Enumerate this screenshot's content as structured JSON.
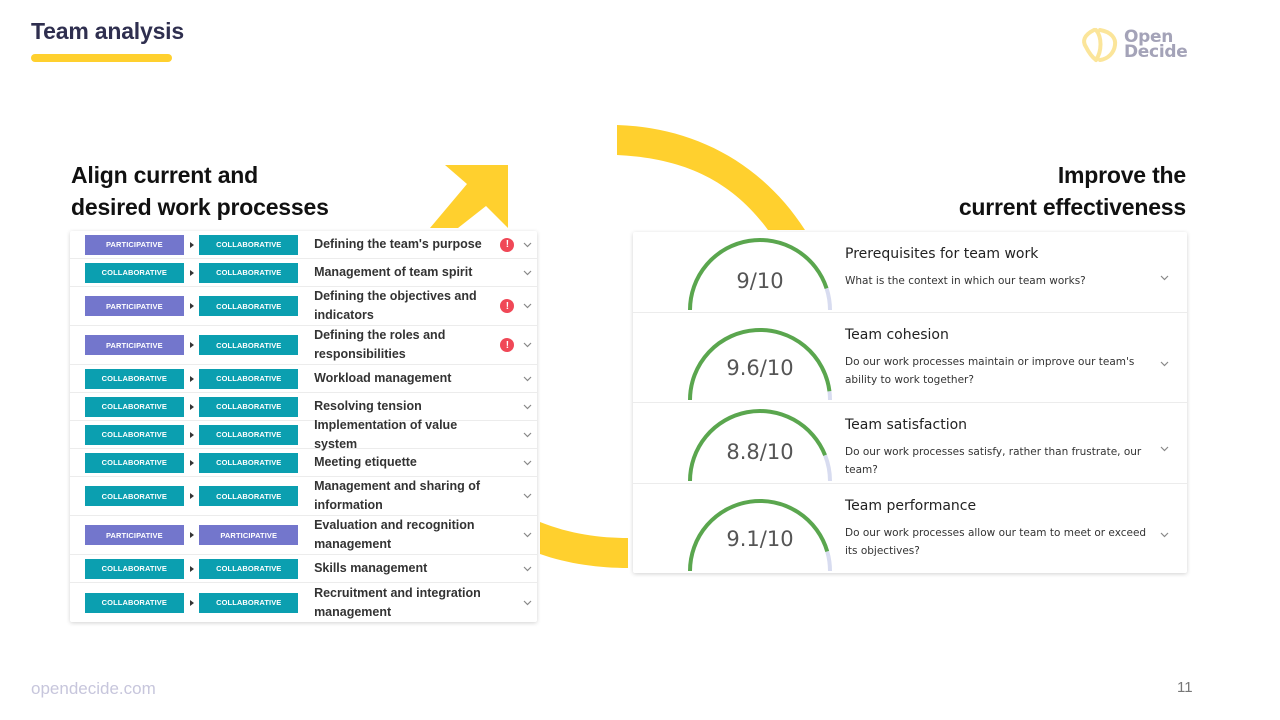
{
  "header": {
    "title": "Team analysis",
    "logo": {
      "line1": "Open",
      "line2": "Decide",
      "icon": "open-decide-logo-icon"
    }
  },
  "colors": {
    "accent_yellow": "#ffd02e",
    "participative": "#7376cc",
    "collaborative": "#0b9fb0",
    "alert": "#f04857",
    "gauge_fill": "#5aa64e",
    "gauge_track": "#d8dcf0"
  },
  "left": {
    "heading_line1": "Align current and",
    "heading_line2": "desired work processes",
    "rows": [
      {
        "current": "PARTICIPATIVE",
        "desired": "COLLABORATIVE",
        "name": "Defining the team's purpose",
        "alert": true
      },
      {
        "current": "COLLABORATIVE",
        "desired": "COLLABORATIVE",
        "name": "Management of team spirit",
        "alert": false
      },
      {
        "current": "PARTICIPATIVE",
        "desired": "COLLABORATIVE",
        "name": "Defining the objectives and indicators",
        "alert": true
      },
      {
        "current": "PARTICIPATIVE",
        "desired": "COLLABORATIVE",
        "name": "Defining the roles and responsibilities",
        "alert": true
      },
      {
        "current": "COLLABORATIVE",
        "desired": "COLLABORATIVE",
        "name": "Workload management",
        "alert": false
      },
      {
        "current": "COLLABORATIVE",
        "desired": "COLLABORATIVE",
        "name": "Resolving tension",
        "alert": false
      },
      {
        "current": "COLLABORATIVE",
        "desired": "COLLABORATIVE",
        "name": "Implementation of value system",
        "alert": false
      },
      {
        "current": "COLLABORATIVE",
        "desired": "COLLABORATIVE",
        "name": "Meeting etiquette",
        "alert": false
      },
      {
        "current": "COLLABORATIVE",
        "desired": "COLLABORATIVE",
        "name": "Management and sharing of information",
        "alert": false
      },
      {
        "current": "PARTICIPATIVE",
        "desired": "PARTICIPATIVE",
        "name": "Evaluation and recognition management",
        "alert": false
      },
      {
        "current": "COLLABORATIVE",
        "desired": "COLLABORATIVE",
        "name": "Skills management",
        "alert": false
      },
      {
        "current": "COLLABORATIVE",
        "desired": "COLLABORATIVE",
        "name": "Recruitment and integration management",
        "alert": false
      }
    ]
  },
  "right": {
    "heading_line1": "Improve the",
    "heading_line2": "current effectiveness",
    "scores": [
      {
        "label": "9/10",
        "value": 9,
        "max": 10,
        "title": "Prerequisites for team work",
        "description": "What is the context in which our team works?"
      },
      {
        "label": "9.6/10",
        "value": 9.6,
        "max": 10,
        "title": "Team cohesion",
        "description": "Do our work processes maintain or improve our team's ability to work together?"
      },
      {
        "label": "8.8/10",
        "value": 8.8,
        "max": 10,
        "title": "Team satisfaction",
        "description": "Do our work processes satisfy, rather than frustrate, our team?"
      },
      {
        "label": "9.1/10",
        "value": 9.1,
        "max": 10,
        "title": "Team performance",
        "description": "Do our work processes allow our team to meet or exceed its objectives?"
      }
    ]
  },
  "footer": {
    "url": "opendecide.com",
    "page_number": "11"
  }
}
